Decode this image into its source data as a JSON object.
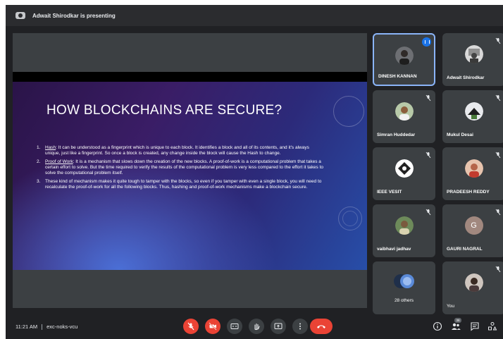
{
  "presenting_banner": "Adwait Shirodkar is presenting",
  "slide": {
    "title": "HOW BLOCKCHAINS ARE SECURE?",
    "items": [
      {
        "num": "1.",
        "term": "Hash",
        "text": ": It can be understood as a fingerprint which is unique to each block. It identifies a block and all of its contents, and it's always unique, just like a fingerprint. So once a block is created, any change inside the block will cause the Hash to change."
      },
      {
        "num": "2.",
        "term": "Proof of Work",
        "text": ": It is a mechanism that slows down the creation of the new blocks. A proof-of-work is a computational problem that takes a certain effort to solve. But the time required to verify the results of the computational problem is very less compared to the effort it takes to solve the computational problem itself."
      },
      {
        "num": "3.",
        "term": "",
        "text": "These kind of mechanism makes it quite tough to tamper with the blocks, so even if you tamper with even a single block, you will need to recalculate the proof-of-work for all the following blocks. Thus, hashing and proof-of-work mechanisms make a blockchain secure."
      }
    ]
  },
  "participants": [
    {
      "name": "DINESH KANNAN",
      "speaking": true,
      "muted": false,
      "avatar": "photo"
    },
    {
      "name": "Adwait Shirodkar",
      "speaking": false,
      "muted": true,
      "avatar": "photo"
    },
    {
      "name": "Simran Huddedar",
      "speaking": false,
      "muted": true,
      "avatar": "photo"
    },
    {
      "name": "Mukul Desai",
      "speaking": false,
      "muted": true,
      "avatar": "photo"
    },
    {
      "name": "IEEE VESIT",
      "speaking": false,
      "muted": true,
      "avatar": "logo"
    },
    {
      "name": "PRADEESH REDDY",
      "speaking": false,
      "muted": true,
      "avatar": "photo"
    },
    {
      "name": "vaibhavi jadhav",
      "speaking": false,
      "muted": true,
      "avatar": "photo"
    },
    {
      "name": "GAURI NAGRAL",
      "speaking": false,
      "muted": true,
      "avatar": "initial",
      "initial": "G"
    },
    {
      "name": "28 others",
      "speaking": false,
      "muted": false,
      "avatar": "group"
    },
    {
      "name": "You",
      "speaking": false,
      "muted": true,
      "avatar": "photo"
    }
  ],
  "bottom": {
    "time": "11:21 AM",
    "meeting_code": "exc-noks-vcu",
    "people_count": "38"
  },
  "colors": {
    "background": "#202124",
    "tile": "#3c4043",
    "danger": "#ea4335",
    "speaking_border": "#8ab4f8"
  },
  "icons": {
    "controls": [
      "mic-off-icon",
      "camera-off-icon",
      "captions-icon",
      "raise-hand-icon",
      "present-screen-icon",
      "more-options-icon",
      "leave-call-icon"
    ],
    "right": [
      "info-icon",
      "people-icon",
      "chat-icon",
      "activities-icon"
    ]
  }
}
